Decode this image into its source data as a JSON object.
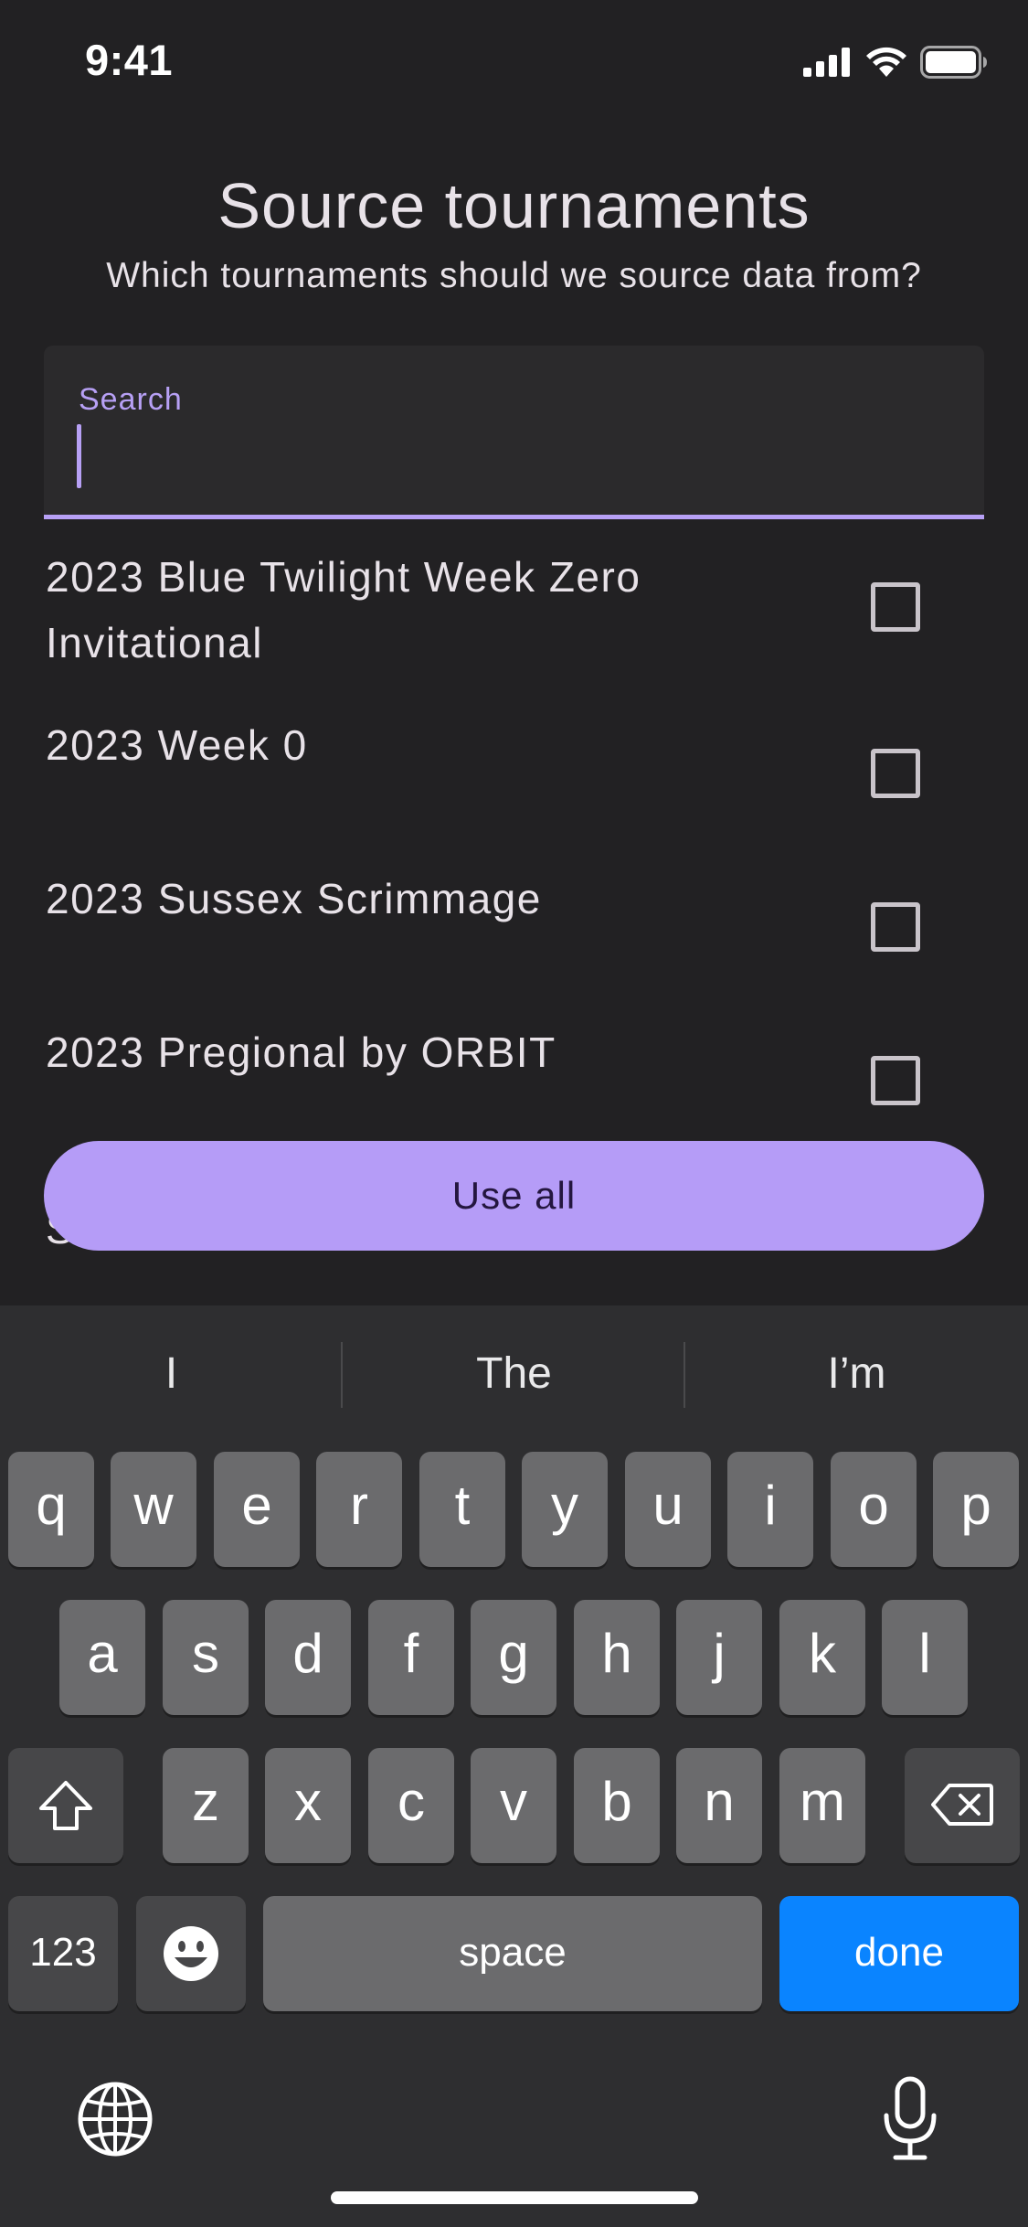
{
  "status_bar": {
    "time": "9:41",
    "icons": [
      "cellular-signal-icon",
      "wifi-icon",
      "battery-icon"
    ]
  },
  "header": {
    "title": "Source tournaments",
    "subtitle": "Which tournaments should we source data from?"
  },
  "search": {
    "label": "Search",
    "value": "",
    "placeholder": ""
  },
  "tournaments": [
    {
      "label": "2023 Blue Twilight Week Zero Invitational",
      "checked": false
    },
    {
      "label": "2023 Week 0",
      "checked": false
    },
    {
      "label": "2023 Sussex Scrimmage",
      "checked": false
    },
    {
      "label": "2023 Pregional by ORBIT",
      "checked": false
    },
    {
      "label": "Session",
      "checked": false
    }
  ],
  "actions": {
    "use_all_label": "Use all"
  },
  "keyboard": {
    "suggestions": [
      "I",
      "The",
      "I’m"
    ],
    "row1": [
      "q",
      "w",
      "e",
      "r",
      "t",
      "y",
      "u",
      "i",
      "o",
      "p"
    ],
    "row2": [
      "a",
      "s",
      "d",
      "f",
      "g",
      "h",
      "j",
      "k",
      "l"
    ],
    "row3": [
      "z",
      "x",
      "c",
      "v",
      "b",
      "n",
      "m"
    ],
    "numbers_label": "123",
    "space_label": "space",
    "done_label": "done"
  },
  "colors": {
    "background": "#222123",
    "accent": "#b59cf7",
    "done_key": "#0a84ff"
  }
}
